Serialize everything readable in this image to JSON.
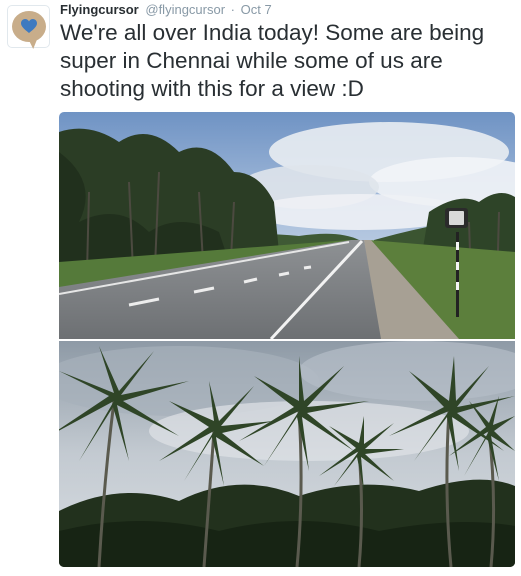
{
  "tweet": {
    "author_name": "Flyingcursor",
    "handle": "@flyingcursor",
    "separator": "·",
    "timestamp": "Oct 7",
    "text": "We're all over India today! Some are being super in Chennai while some of us are shooting with this for a view :D"
  },
  "avatar": {
    "icon": "heart-icon",
    "bubble_color": "#c8ad8a",
    "heart_color": "#3e7ac0"
  },
  "media": {
    "photos": [
      {
        "name": "highway-photo",
        "subject": "highway through palm trees"
      },
      {
        "name": "palm-trees-photo",
        "subject": "coconut palm trees under cloudy sky"
      }
    ]
  },
  "colors": {
    "text": "#292f33",
    "secondary": "#8899a6"
  }
}
